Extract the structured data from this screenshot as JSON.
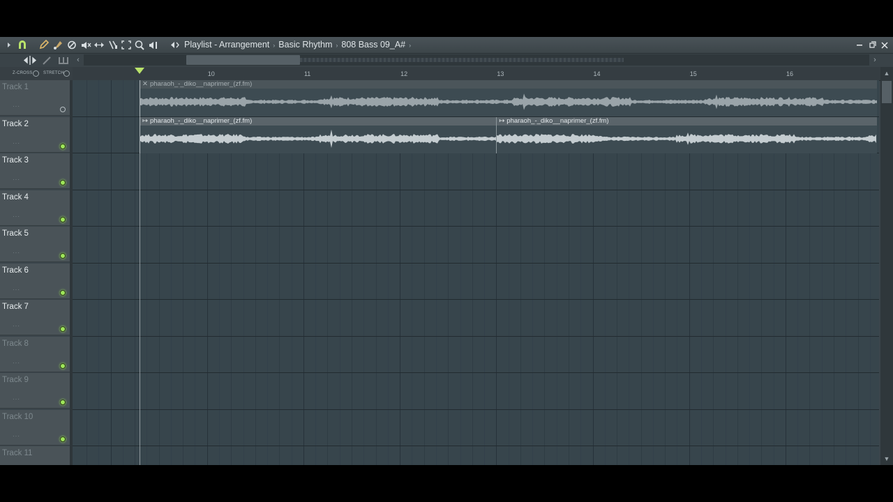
{
  "window": {
    "title": "Playlist - Arrangement",
    "breadcrumb_1": "Basic Rhythm",
    "breadcrumb_2": "808 Bass 09_A#",
    "breadcrumb_sep": "›"
  },
  "options": {
    "zcross_label": "Z-CROSS",
    "stretch_label": "STRETCH"
  },
  "ruler": {
    "bars": [
      {
        "label": "10",
        "bar": 10
      },
      {
        "label": "11",
        "bar": 11
      },
      {
        "label": "12",
        "bar": 12
      },
      {
        "label": "13",
        "bar": 13
      },
      {
        "label": "14",
        "bar": 14
      },
      {
        "label": "15",
        "bar": 15
      },
      {
        "label": "16",
        "bar": 16
      }
    ]
  },
  "tracks": [
    {
      "name": "Track 1",
      "dim": true,
      "led": "off"
    },
    {
      "name": "Track 2",
      "dim": false,
      "led": "on"
    },
    {
      "name": "Track 3",
      "dim": false,
      "led": "on"
    },
    {
      "name": "Track 4",
      "dim": false,
      "led": "on"
    },
    {
      "name": "Track 5",
      "dim": false,
      "led": "on"
    },
    {
      "name": "Track 6",
      "dim": false,
      "led": "on"
    },
    {
      "name": "Track 7",
      "dim": false,
      "led": "on"
    },
    {
      "name": "Track 8",
      "dim": true,
      "led": "on"
    },
    {
      "name": "Track 9",
      "dim": true,
      "led": "on"
    },
    {
      "name": "Track 10",
      "dim": true,
      "led": "on"
    },
    {
      "name": "Track 11",
      "dim": true,
      "led": "on"
    }
  ],
  "clips": [
    {
      "track": 1,
      "label": "pharaoh_-_diko__naprimer_(zf.fm)",
      "marker": "✕",
      "muted": true,
      "start_bar": 9.3,
      "end_bar": 16.95
    },
    {
      "track": 2,
      "label": "pharaoh_-_diko__naprimer_(zf.fm)",
      "marker": "↦",
      "muted": false,
      "start_bar": 9.3,
      "end_bar": 13.0
    },
    {
      "track": 2,
      "label": "pharaoh_-_diko__naprimer_(zf.fm)",
      "marker": "↦",
      "muted": false,
      "start_bar": 13.0,
      "end_bar": 16.95
    }
  ],
  "playhead_bar": 9.3,
  "colors": {
    "led_on": "#9ee65a",
    "playhead": "#b9e36a",
    "grid_bg": "#37454c",
    "header_bg": "#4a5358"
  }
}
